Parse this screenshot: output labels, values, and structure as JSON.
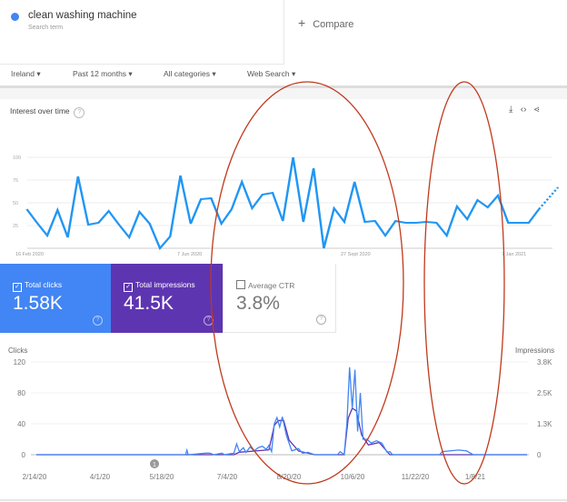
{
  "trends": {
    "search_term": "clean washing machine",
    "search_term_sub": "Search term",
    "compare_label": "Compare",
    "filters": [
      "Ireland",
      "Past 12 months",
      "All categories",
      "Web Search"
    ],
    "section_title": "Interest over time",
    "icons": [
      "download-icon",
      "embed-code-icon",
      "share-icon"
    ]
  },
  "search_console": {
    "cards": [
      {
        "label": "Total clicks",
        "value": "1.58K",
        "checked": true,
        "color": "#4285f4"
      },
      {
        "label": "Total impressions",
        "value": "41.5K",
        "checked": true,
        "color": "#5e35b1"
      },
      {
        "label": "Average CTR",
        "value": "3.8%",
        "checked": false,
        "color": "#ffffff"
      }
    ],
    "annotation_marker": "1"
  },
  "chart_data": [
    {
      "type": "line",
      "title": "Interest over time",
      "line_color": "#2196f3",
      "x_tick_labels": [
        "16 Feb 2020",
        "7 Jun 2020",
        "27 Sept 2020",
        "7 Jan 2021"
      ],
      "y_ticks": [
        25,
        50,
        75,
        100
      ],
      "ylim": [
        0,
        100
      ],
      "grid": true,
      "values": [
        43,
        28,
        14,
        42,
        12,
        79,
        26,
        28,
        41,
        26,
        12,
        40,
        27,
        0,
        13,
        80,
        27,
        54,
        55,
        27,
        43,
        73,
        44,
        59,
        61,
        30,
        100,
        29,
        88,
        0,
        44,
        29,
        73,
        29,
        30,
        14,
        30,
        28,
        28,
        29,
        28,
        14,
        46,
        32,
        53,
        45,
        58,
        28,
        28,
        28,
        43
      ],
      "partial_value": 67
    },
    {
      "type": "line",
      "ylabel_left": "Clicks",
      "ylabel_right": "Impressions",
      "y_ticks_left": [
        "0",
        "40",
        "80",
        "120"
      ],
      "y_ticks_right": [
        "0",
        "1.3K",
        "2.5K",
        "3.8K"
      ],
      "ylim": [
        0,
        120
      ],
      "x_tick_labels": [
        "2/14/20",
        "4/1/20",
        "5/18/20",
        "7/4/20",
        "8/20/20",
        "10/6/20",
        "11/22/20",
        "1/8/21"
      ],
      "series": [
        {
          "name": "Clicks",
          "color": "#4285f4",
          "points": [
            [
              "2020-02-14",
              0
            ],
            [
              "2020-06-04",
              0
            ],
            [
              "2020-06-05",
              6
            ],
            [
              "2020-06-06",
              0
            ],
            [
              "2020-06-19",
              2
            ],
            [
              "2020-06-22",
              2
            ],
            [
              "2020-06-25",
              0
            ],
            [
              "2020-07-01",
              2
            ],
            [
              "2020-07-03",
              0
            ],
            [
              "2020-07-10",
              2
            ],
            [
              "2020-07-12",
              14
            ],
            [
              "2020-07-14",
              4
            ],
            [
              "2020-07-17",
              9
            ],
            [
              "2020-07-19",
              3
            ],
            [
              "2020-07-22",
              10
            ],
            [
              "2020-07-25",
              5
            ],
            [
              "2020-07-28",
              9
            ],
            [
              "2020-07-31",
              11
            ],
            [
              "2020-08-03",
              7
            ],
            [
              "2020-08-05",
              12
            ],
            [
              "2020-08-07",
              4
            ],
            [
              "2020-08-09",
              40
            ],
            [
              "2020-08-11",
              48
            ],
            [
              "2020-08-13",
              36
            ],
            [
              "2020-08-15",
              49
            ],
            [
              "2020-08-18",
              25
            ],
            [
              "2020-08-22",
              5
            ],
            [
              "2020-08-27",
              8
            ],
            [
              "2020-08-30",
              2
            ],
            [
              "2020-09-03",
              3
            ],
            [
              "2020-09-08",
              0
            ],
            [
              "2020-09-25",
              0
            ],
            [
              "2020-09-27",
              4
            ],
            [
              "2020-09-30",
              0
            ],
            [
              "2020-10-02",
              40
            ],
            [
              "2020-10-04",
              113
            ],
            [
              "2020-10-06",
              60
            ],
            [
              "2020-10-08",
              110
            ],
            [
              "2020-10-10",
              30
            ],
            [
              "2020-10-12",
              80
            ],
            [
              "2020-10-14",
              20
            ],
            [
              "2020-10-17",
              20
            ],
            [
              "2020-10-20",
              15
            ],
            [
              "2020-10-24",
              18
            ],
            [
              "2020-10-28",
              15
            ],
            [
              "2020-11-01",
              3
            ],
            [
              "2020-11-03",
              4
            ],
            [
              "2020-11-05",
              0
            ],
            [
              "2020-12-10",
              0
            ],
            [
              "2020-12-12",
              4
            ],
            [
              "2020-12-18",
              5
            ],
            [
              "2020-12-24",
              6
            ],
            [
              "2020-12-30",
              5
            ],
            [
              "2021-01-04",
              0
            ],
            [
              "2021-02-13",
              0
            ]
          ]
        },
        {
          "name": "Impressions",
          "color": "#5e35b1",
          "points": [
            [
              "2020-02-14",
              0
            ],
            [
              "2020-07-10",
              0
            ],
            [
              "2020-07-14",
              100
            ],
            [
              "2020-07-25",
              150
            ],
            [
              "2020-08-05",
              200
            ],
            [
              "2020-08-09",
              1200
            ],
            [
              "2020-08-12",
              1400
            ],
            [
              "2020-08-16",
              1400
            ],
            [
              "2020-08-20",
              600
            ],
            [
              "2020-08-27",
              150
            ],
            [
              "2020-09-08",
              0
            ],
            [
              "2020-09-30",
              0
            ],
            [
              "2020-10-03",
              1500
            ],
            [
              "2020-10-06",
              1900
            ],
            [
              "2020-10-09",
              1800
            ],
            [
              "2020-10-13",
              800
            ],
            [
              "2020-10-18",
              400
            ],
            [
              "2020-10-26",
              500
            ],
            [
              "2020-11-03",
              0
            ],
            [
              "2021-02-13",
              0
            ]
          ]
        }
      ]
    }
  ]
}
